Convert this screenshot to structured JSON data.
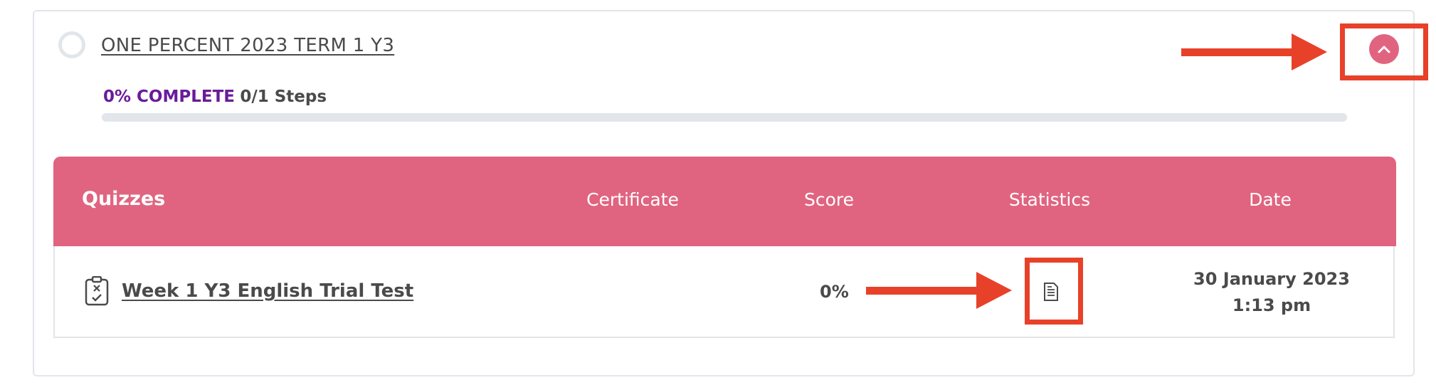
{
  "course": {
    "title": "ONE PERCENT 2023 TERM 1 Y3",
    "progress_percent_label": "0% COMPLETE",
    "progress_steps_label": "0/1 Steps",
    "progress_fraction": 0
  },
  "table": {
    "headers": {
      "quizzes": "Quizzes",
      "certificate": "Certificate",
      "score": "Score",
      "statistics": "Statistics",
      "date": "Date"
    },
    "rows": [
      {
        "quiz_name": "Week 1 Y3 English Trial Test",
        "score": "0%",
        "date_line1": "30 January 2023",
        "date_line2": "1:13 pm"
      }
    ]
  },
  "icons": {
    "status": "status-circle-icon",
    "collapse": "chevron-up-icon",
    "quiz": "quiz-icon",
    "statistics": "statistics-document-icon"
  },
  "colors": {
    "accent": "#e06480",
    "progress": "#6a1b9a",
    "annotation": "#e8412a",
    "text": "#4a4a4a"
  }
}
